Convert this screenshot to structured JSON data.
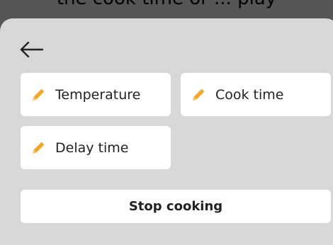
{
  "header": {
    "partial_title": "the cook time or ... play"
  },
  "nav": {
    "back_icon": "arrow-left-icon"
  },
  "options": [
    {
      "label": "Temperature",
      "icon": "pencil-icon"
    },
    {
      "label": "Cook time",
      "icon": "pencil-icon"
    },
    {
      "label": "Delay time",
      "icon": "pencil-icon"
    }
  ],
  "actions": {
    "stop_label": "Stop cooking"
  },
  "colors": {
    "accent": "#f5a623",
    "sheet": "#d8d8d8",
    "overlay": "#555555",
    "card": "#ffffff"
  }
}
